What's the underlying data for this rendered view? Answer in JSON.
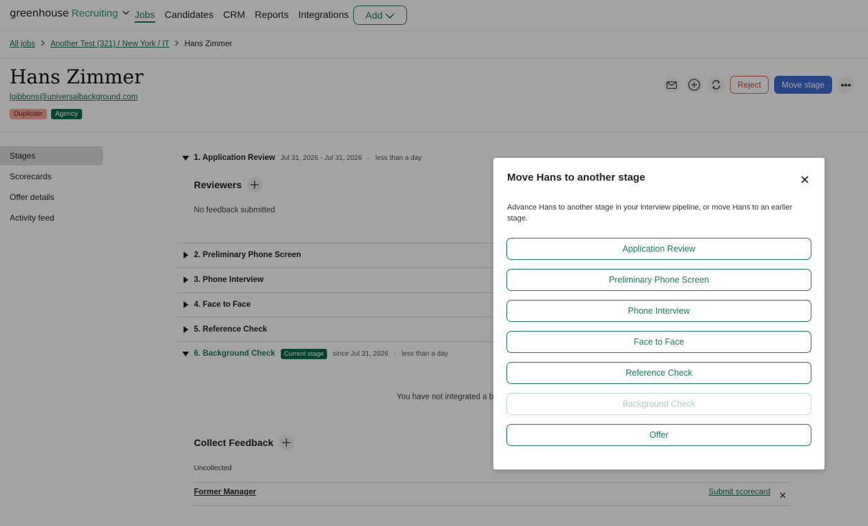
{
  "nav": {
    "brand": "greenhouse",
    "product": "Recruiting",
    "links": [
      "Jobs",
      "Candidates",
      "CRM",
      "Reports",
      "Integrations"
    ],
    "add_label": "Add"
  },
  "breadcrumb": {
    "all_jobs": "All jobs",
    "job": "Another Test (321) / New York / IT",
    "current": "Hans Zimmer"
  },
  "candidate": {
    "name": "Hans Zimmer",
    "email": "lgibbons@universalbackground.com",
    "tags": [
      "Duplicate",
      "Agency"
    ]
  },
  "actions": {
    "reject": "Reject",
    "move_stage": "Move stage",
    "more": "•••"
  },
  "sidebar": {
    "items": [
      "Stages",
      "Scorecards",
      "Offer details",
      "Activity feed"
    ]
  },
  "stages": {
    "s1": {
      "name": "1. Application Review",
      "dates": "Jul 31, 2026 - Jul 31, 2026",
      "dot": "·",
      "duration": "less than a day"
    },
    "reviewers_title": "Reviewers",
    "no_feedback": "No feedback submitted",
    "s2": "2. Preliminary Phone Screen",
    "s3": "3. Phone Interview",
    "s4": "4. Face to Face",
    "s5": "5. Reference Check",
    "s6": {
      "name": "6. Background Check",
      "badge": "Current stage",
      "since": "since Jul 31, 2026",
      "dot": "·",
      "duration": "less than a day"
    },
    "not_integrated": "You have not integrated a b",
    "collect_title": "Collect Feedback",
    "uncollected": "Uncollected",
    "former_manager": "Former Manager",
    "submit_scorecard": "Submit scorecard"
  },
  "modal": {
    "title": "Move Hans to another stage",
    "description": "Advance Hans to another stage in your interview pipeline, or move Hans to an earlier stage.",
    "options": [
      "Application Review",
      "Preliminary Phone Screen",
      "Phone Interview",
      "Face to Face",
      "Reference Check",
      "Background Check",
      "Offer"
    ],
    "disabled_option": "Background Check"
  }
}
